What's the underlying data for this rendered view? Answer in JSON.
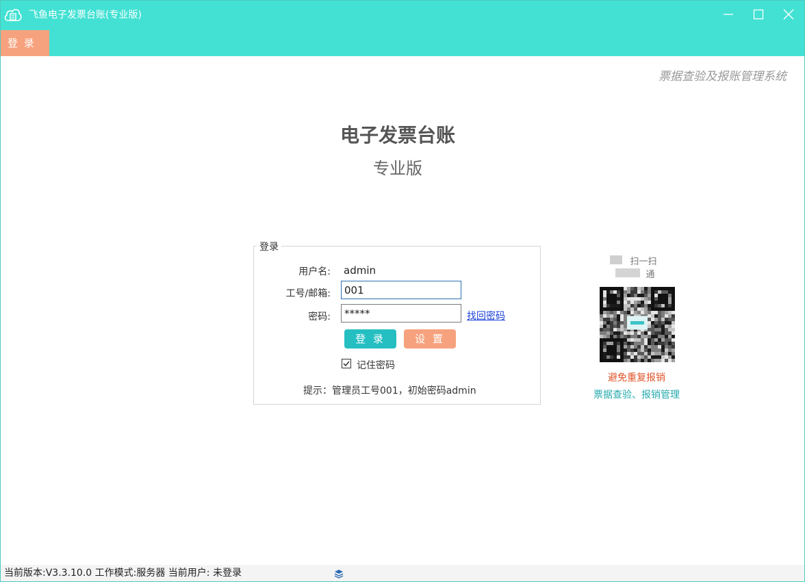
{
  "window": {
    "title": "飞鱼电子发票台账(专业版)",
    "accent_color": "#43e1d3",
    "icons": [
      "cloud-app-icon",
      "minimize-icon",
      "maximize-icon",
      "close-icon"
    ]
  },
  "menu": {
    "items": [
      {
        "label": "登 录",
        "color": "#f7a27e"
      }
    ]
  },
  "header": {
    "slogan": "票据查验及报账管理系统",
    "title": "电子发票台账",
    "edition": "专业版"
  },
  "login": {
    "legend": "登录",
    "username_label": "用户名:",
    "username_value": "admin",
    "id_label": "工号/邮箱:",
    "id_value": "001",
    "password_label": "密码:",
    "password_value": "*****",
    "forgot_link": "找回密码",
    "login_button": "登 录",
    "login_button_color": "#25bfc2",
    "settings_button": "设 置",
    "settings_button_color": "#f7a27e",
    "remember_label": "记住密码",
    "remember_checked": true,
    "hint": "提示：管理员工号001，初始密码admin"
  },
  "qr": {
    "line1": "扫一扫",
    "line2": "通",
    "slogan_red": "避免重复报销",
    "slogan_teal": "票据查验、报销管理"
  },
  "status": {
    "text": "当前版本:V3.3.10.0  工作模式:服务器  当前用户:  未登录",
    "icon": "layers-icon"
  }
}
